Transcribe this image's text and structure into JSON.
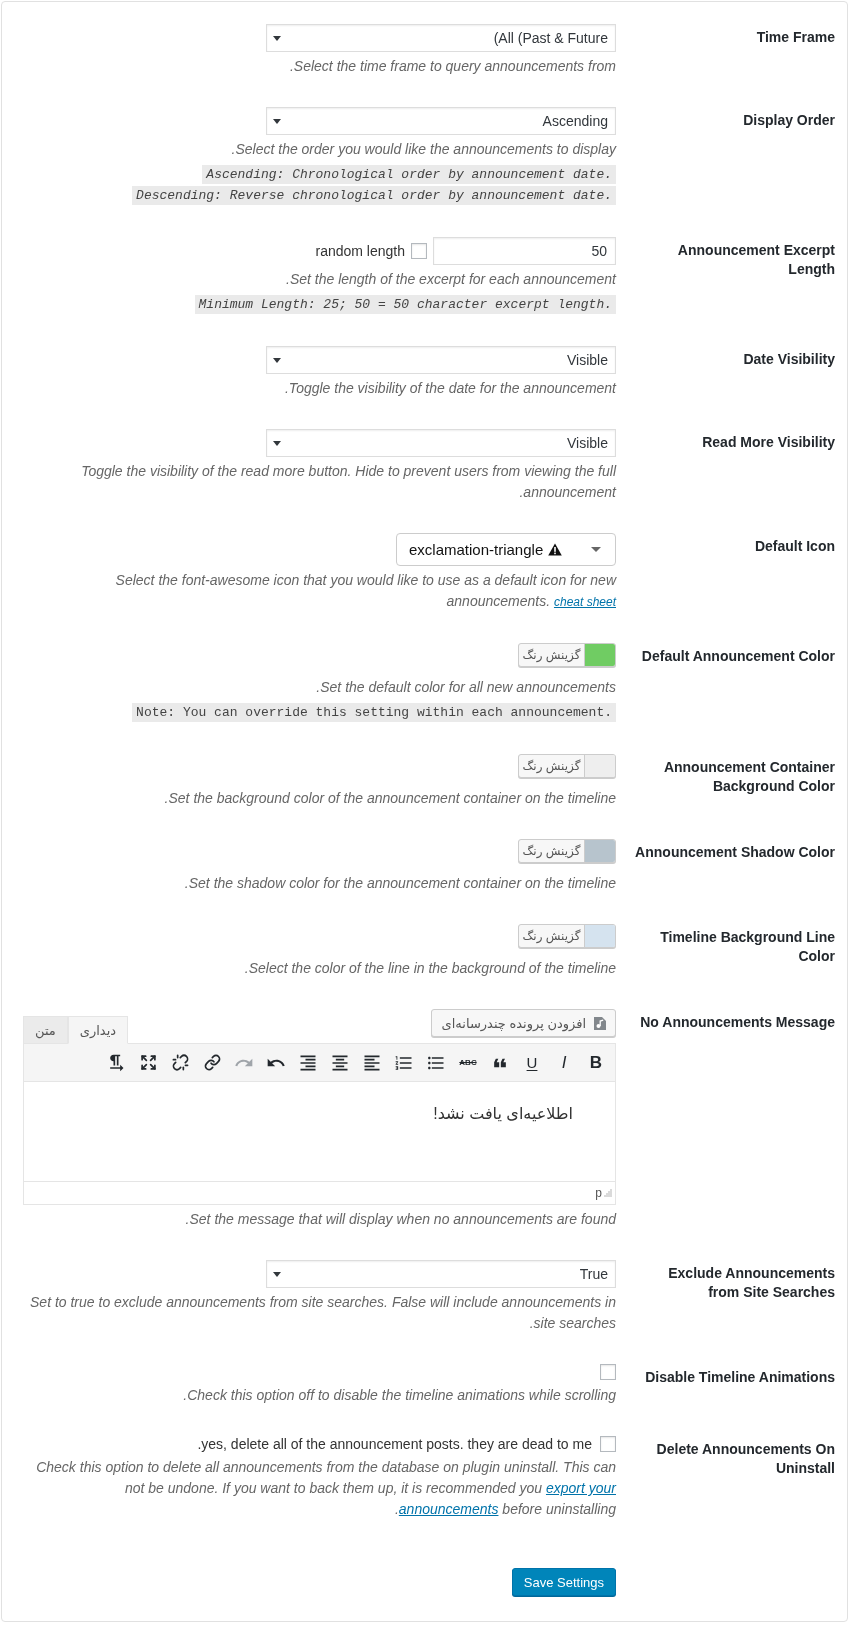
{
  "settings": [
    {
      "kind": "select",
      "label": "Time Frame",
      "value": "(All (Past & Future",
      "description": ".Select the time frame to query announcements from"
    },
    {
      "kind": "select",
      "label": "Display Order",
      "value": "Ascending",
      "description": ".Select the order you would like the announcements to display",
      "notes": [
        {
          "text": "Ascending: Chronological order by announcement date.",
          "italic": true
        },
        {
          "text": "Descending: Reverse chronological order by announcement date.",
          "italic": true
        }
      ]
    },
    {
      "kind": "number",
      "label": "Announcement Excerpt Length",
      "value": "50",
      "checkbox": {
        "label": "random length",
        "checked": false
      },
      "description": ".Set the length of the excerpt for each announcement",
      "notes": [
        {
          "text": "Minimum Length: 25; 50 = 50 character excerpt length.",
          "italic": true
        }
      ]
    },
    {
      "kind": "select",
      "label": "Date Visibility",
      "value": "Visible",
      "description": ".Toggle the visibility of the date for the announcement"
    },
    {
      "kind": "select",
      "label": "Read More Visibility",
      "value": "Visible",
      "description": "Toggle the visibility of the read more button. Hide to prevent users from viewing the full .announcement"
    },
    {
      "kind": "icon_select",
      "label": "Default Icon",
      "value": "exclamation-triangle",
      "description_parts": [
        {
          "kind": "text",
          "text": "Select the font-awesome icon that you would like to use as a default icon for new announcements. "
        },
        {
          "kind": "link",
          "text": "cheat sheet",
          "small": true
        }
      ]
    },
    {
      "kind": "color",
      "label": "Default Announcement Color",
      "button": "گزینش رنگ",
      "color": "#70cc63",
      "description": ".Set the default color for all new announcements",
      "notes": [
        {
          "text": "Note: You can override this setting within each announcement.",
          "italic": false
        }
      ]
    },
    {
      "kind": "color",
      "label": "Announcement Container Background Color",
      "button": "گزینش رنگ",
      "color": "#eeeeee",
      "description": ".Set the background color of the announcement container on the timeline"
    },
    {
      "kind": "color",
      "label": "Announcement Shadow Color",
      "button": "گزینش رنگ",
      "color": "#b7c4cd",
      "description": ".Set the shadow color for the announcement container on the timeline"
    },
    {
      "kind": "color",
      "label": "Timeline Background Line Color",
      "button": "گزینش رنگ",
      "color": "#d5e3ef",
      "description": ".Select the color of the line in the background of the timeline"
    },
    {
      "kind": "editor",
      "label": "No Announcements Message",
      "media_button": "افزودن پرونده چندرسانه‌ای",
      "tabs": [
        {
          "label": "دیداری",
          "selected": true
        },
        {
          "label": "متن",
          "selected": false
        }
      ],
      "toolbar": [
        {
          "kind": "textdirection",
          "disabled": false
        },
        {
          "kind": "fullscreen",
          "disabled": false
        },
        {
          "kind": "unlink",
          "disabled": false
        },
        {
          "kind": "link",
          "disabled": false
        },
        {
          "kind": "redo",
          "disabled": true
        },
        {
          "kind": "undo",
          "disabled": false
        },
        {
          "kind": "alignright",
          "disabled": false
        },
        {
          "kind": "aligncenter",
          "disabled": false
        },
        {
          "kind": "alignleft",
          "disabled": false
        },
        {
          "kind": "numberedlist",
          "disabled": false
        },
        {
          "kind": "bulletlist",
          "disabled": false
        },
        {
          "kind": "strikethrough",
          "label": "ABC",
          "disabled": false
        },
        {
          "kind": "blockquote",
          "disabled": false
        },
        {
          "kind": "underline",
          "label": "U",
          "disabled": false
        },
        {
          "kind": "italic",
          "label": "I",
          "disabled": false
        },
        {
          "kind": "bold",
          "label": "B",
          "disabled": false
        }
      ],
      "content": "اطلاعیه‌ای یافت نشد!",
      "path": "p",
      "description": ".Set the message that will display when no announcements are found"
    },
    {
      "kind": "select",
      "label": "Exclude Announcements from Site Searches",
      "value": "True",
      "description": "Set to true to exclude announcements from site searches. False will include announcements in .site searches"
    },
    {
      "kind": "checkbox",
      "label": "Disable Timeline Animations",
      "checked": false,
      "description": ".Check this option off to disable the timeline animations while scrolling"
    },
    {
      "kind": "checkbox",
      "label": "Delete Announcements On Uninstall",
      "checked": false,
      "checkbox_label": ".yes, delete all of the announcement posts. they are dead to me",
      "description_parts": [
        {
          "kind": "text",
          "text": "Check this option to delete all announcements from the database on plugin uninstall. This can not be undone. If you want to back them up, it is recommended you "
        },
        {
          "kind": "link",
          "text": "export your",
          "small": false
        },
        {
          "kind": "text",
          "text": " ."
        },
        {
          "kind": "link",
          "text": "announcements",
          "small": false
        },
        {
          "kind": "text",
          "text": " before uninstalling"
        }
      ]
    }
  ],
  "save_button": "Save Settings"
}
